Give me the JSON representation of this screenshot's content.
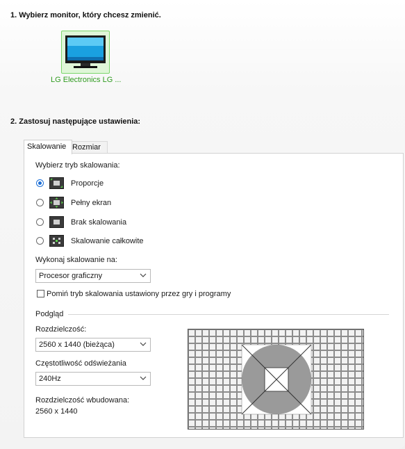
{
  "section1": {
    "title": "1. Wybierz monitor, który chcesz zmienić."
  },
  "monitor": {
    "label": "LG Electronics LG ...",
    "icon": "monitor-icon"
  },
  "section2": {
    "title": "2. Zastosuj następujące ustawienia:"
  },
  "tabs": [
    {
      "label": "Skalowanie",
      "active": true
    },
    {
      "label": "Rozmiar",
      "active": false
    }
  ],
  "scaling": {
    "mode_label": "Wybierz tryb skalowania:",
    "options": [
      {
        "label": "Proporcje",
        "selected": true,
        "icon": "aspect-ratio-icon"
      },
      {
        "label": "Pełny ekran",
        "selected": false,
        "icon": "full-screen-icon"
      },
      {
        "label": "Brak skalowania",
        "selected": false,
        "icon": "no-scaling-icon"
      },
      {
        "label": "Skalowanie całkowite",
        "selected": false,
        "icon": "integer-scaling-icon"
      }
    ],
    "perform_on_label": "Wykonaj skalowanie na:",
    "perform_on_value": "Procesor graficzny",
    "override_label": "Pomiń tryb skalowania ustawiony przez gry i programy",
    "override_checked": false
  },
  "preview": {
    "group_label": "Podgląd",
    "resolution_label": "Rozdzielczość:",
    "resolution_value": "2560 x 1440 (bieżąca)",
    "refresh_label": "Częstotliwość odświeżania",
    "refresh_value": "240Hz",
    "native_label": "Rozdzielczość wbudowana:",
    "native_value": "2560 x 1440"
  },
  "colors": {
    "accent": "#1d6fd6",
    "selected_tile": "#dff6d8",
    "monitor_label": "#2f9b1f"
  }
}
